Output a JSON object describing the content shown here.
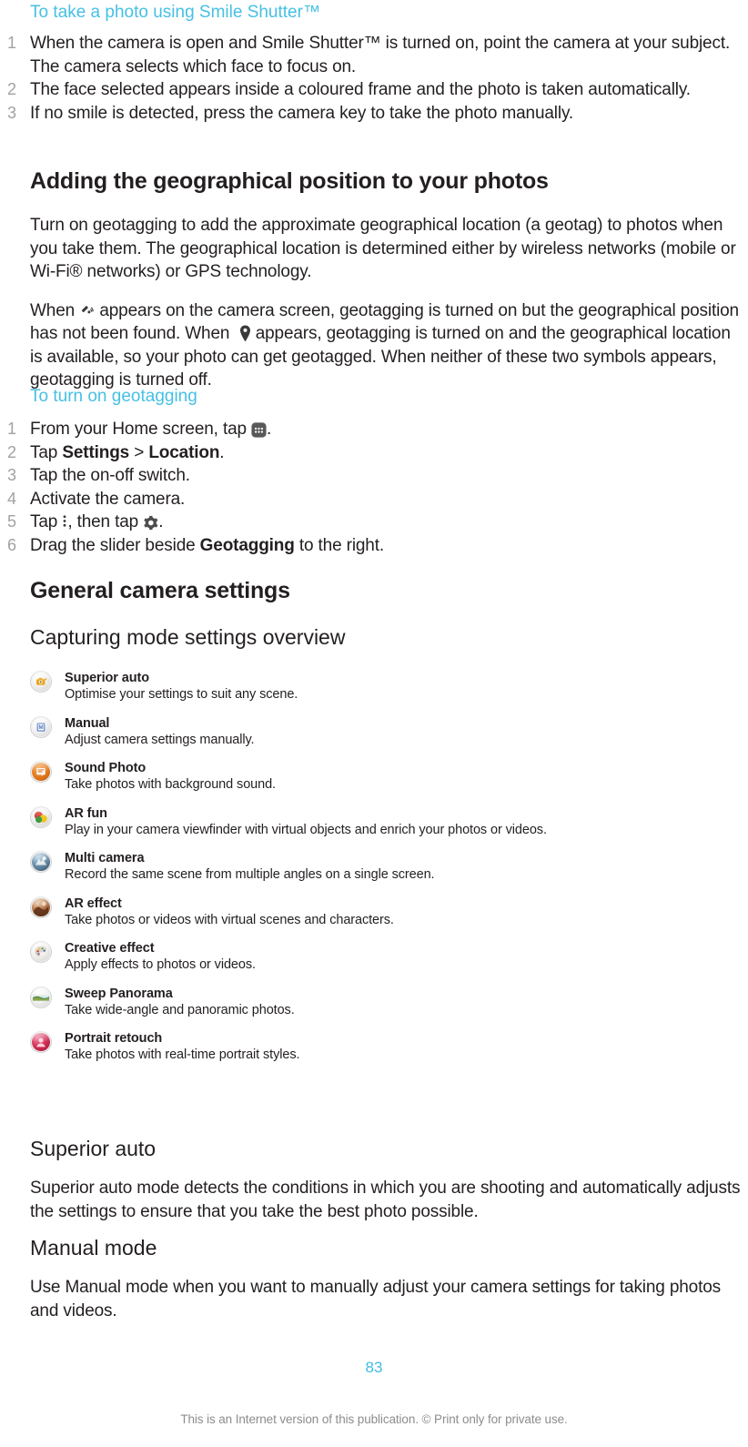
{
  "sections": {
    "smile_shutter": {
      "heading": "To take a photo using Smile Shutter™",
      "steps": [
        "When the camera is open and Smile Shutter™ is turned on, point the camera at your subject. The camera selects which face to focus on.",
        "The face selected appears inside a coloured frame and the photo is taken automatically.",
        "If no smile is detected, press the camera key to take the photo manually."
      ],
      "step_numbers": [
        "1",
        "2",
        "3"
      ]
    },
    "geo": {
      "heading": "Adding the geographical position to your photos",
      "paragraph_1": "Turn on geotagging to add the approximate geographical location (a geotag) to photos when you take them. The geographical location is determined either by wireless networks (mobile or Wi-Fi® networks) or GPS technology.",
      "paragraph_2_part_1": "When",
      "paragraph_2_part_2": "appears on the camera screen, geotagging is turned on but the geographical position has not been found. When",
      "paragraph_2_part_3": "appears, geotagging is turned on and the geographical location is available, so your photo can get geotagged. When neither of these two symbols appears, geotagging is turned off.",
      "icon_gps_searching": "gps-searching-icon",
      "icon_location_pin": "location-pin-icon"
    },
    "turn_on_geotagging": {
      "heading": "To turn on geotagging",
      "step_numbers": [
        "1",
        "2",
        "3",
        "4",
        "5",
        "6"
      ],
      "step_1_part_1": "From your Home screen, tap",
      "step_1_part_2": ".",
      "step_1_icon": "app-drawer-icon",
      "step_2_part_1": "Tap",
      "step_2_bold_1": "Settings",
      "step_2_part_2": ">",
      "step_2_bold_2": "Location",
      "step_2_part_3": ".",
      "step_3": "Tap the on-off switch.",
      "step_4": "Activate the camera.",
      "step_5_part_1": "Tap",
      "step_5_part_2": ", then tap",
      "step_5_part_3": ".",
      "step_5_icon_1": "overflow-menu-icon",
      "step_5_icon_2": "gear-icon",
      "step_6_part_1": "Drag the slider beside",
      "step_6_bold": "Geotagging",
      "step_6_part_2": "to the right."
    },
    "general_camera_settings": {
      "heading": "General camera settings",
      "subheading": "Capturing mode settings overview",
      "modes": [
        {
          "icon": "superior-auto-icon",
          "title": "Superior auto",
          "desc": "Optimise your settings to suit any scene."
        },
        {
          "icon": "manual-icon",
          "title": "Manual",
          "desc": "Adjust camera settings manually."
        },
        {
          "icon": "sound-photo-icon",
          "title": "Sound Photo",
          "desc": "Take photos with background sound."
        },
        {
          "icon": "ar-fun-icon",
          "title": "AR fun",
          "desc": "Play in your camera viewfinder with virtual objects and enrich your photos or videos."
        },
        {
          "icon": "multi-camera-icon",
          "title": "Multi camera",
          "desc": "Record the same scene from multiple angles on a single screen."
        },
        {
          "icon": "ar-effect-icon",
          "title": "AR effect",
          "desc": "Take photos or videos with virtual scenes and characters."
        },
        {
          "icon": "creative-effect-icon",
          "title": "Creative effect",
          "desc": "Apply effects to photos or videos."
        },
        {
          "icon": "sweep-panorama-icon",
          "title": "Sweep Panorama",
          "desc": "Take wide-angle and panoramic photos."
        },
        {
          "icon": "portrait-retouch-icon",
          "title": "Portrait retouch",
          "desc": "Take photos with real-time portrait styles."
        }
      ]
    },
    "superior_auto": {
      "heading": "Superior auto",
      "paragraph": "Superior auto mode detects the conditions in which you are shooting and automatically adjusts the settings to ensure that you take the best photo possible."
    },
    "manual_mode": {
      "heading": "Manual mode",
      "paragraph": "Use Manual mode when you want to manually adjust your camera settings for taking photos and videos."
    }
  },
  "footer": {
    "page_number": "83",
    "notice": "This is an Internet version of this publication. © Print only for private use."
  },
  "colors": {
    "accent_blue": "#46c0e4",
    "body_text": "#231f20",
    "list_number_gray": "#a2a2a2",
    "footnote_gray": "#8d8d8d"
  }
}
